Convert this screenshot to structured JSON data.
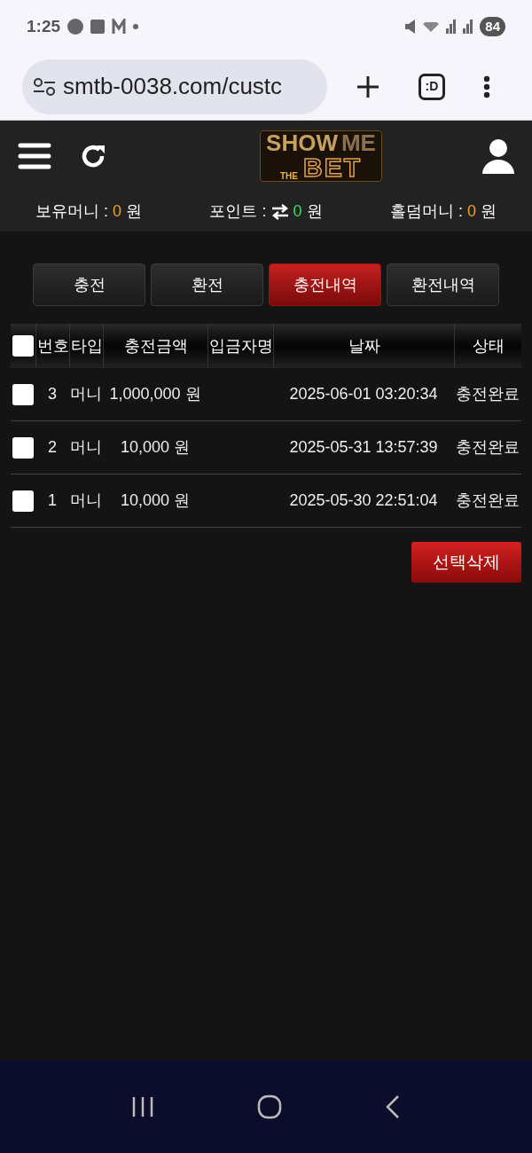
{
  "status_bar": {
    "time": "1:25",
    "battery": "84"
  },
  "browser": {
    "url": "smtb-0038.com/custc",
    "tab_badge": ":D"
  },
  "logo": {
    "top": "SHOW",
    "top_right": "ME",
    "small": "THE",
    "bottom": "BET"
  },
  "balances": [
    {
      "label": "보유머니 :",
      "value": "0",
      "unit": "원",
      "color": "#f0a020",
      "kind": "plain"
    },
    {
      "label": "포인트 :",
      "value": "0",
      "unit": "원",
      "color": "#3ddc5a",
      "kind": "convert"
    },
    {
      "label": "홀덤머니 :",
      "value": "0",
      "unit": "원",
      "color": "#f0a020",
      "kind": "plain"
    }
  ],
  "tabs": [
    {
      "label": "충전",
      "selected": false
    },
    {
      "label": "환전",
      "selected": false
    },
    {
      "label": "충전내역",
      "selected": true
    },
    {
      "label": "환전내역",
      "selected": false
    }
  ],
  "table": {
    "select_all_checked": false,
    "columns": [
      "번호",
      "타입",
      "충전금액",
      "입금자명",
      "날짜",
      "상태"
    ],
    "rows": [
      {
        "checked": false,
        "cells": [
          "3",
          "머니",
          "1,000,000 원",
          "",
          "2025-06-01 03:20:34",
          "충전완료"
        ]
      },
      {
        "checked": false,
        "cells": [
          "2",
          "머니",
          "10,000 원",
          "",
          "2025-05-31 13:57:39",
          "충전완료"
        ]
      },
      {
        "checked": false,
        "cells": [
          "1",
          "머니",
          "10,000 원",
          "",
          "2025-05-30 22:51:04",
          "충전완료"
        ]
      }
    ]
  },
  "delete_button": "선택삭제"
}
